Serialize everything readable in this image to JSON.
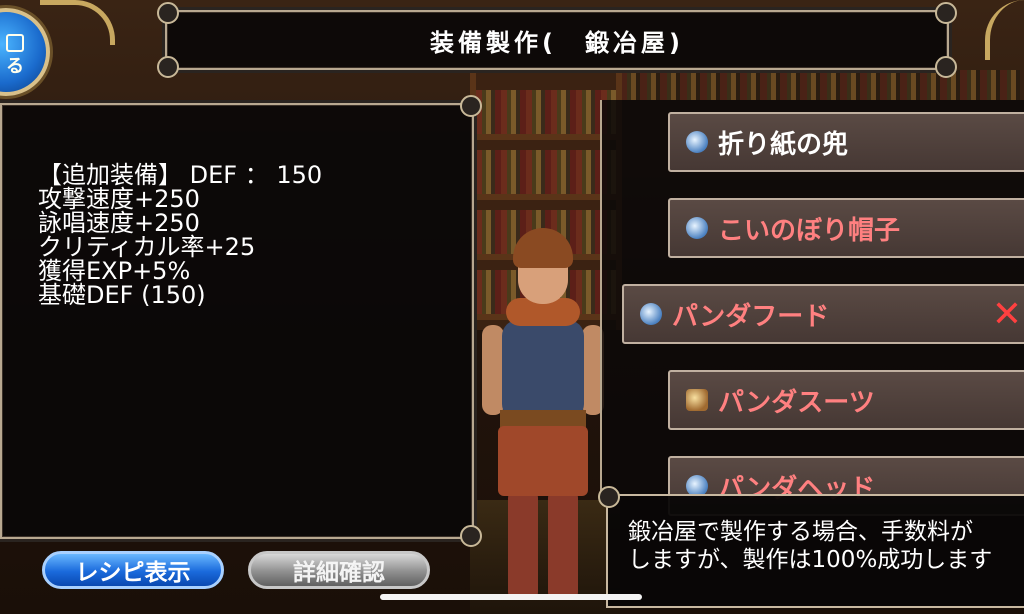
{
  "title": "装備製作(　鍛冶屋)",
  "back_button_label": "る",
  "stats": {
    "lines": [
      "【追加装備】 DEF ： 150",
      "攻撃速度+250",
      "詠唱速度+250",
      "クリティカル率+25",
      "獲得EXP+5%",
      "基礎DEF (150)"
    ]
  },
  "items": [
    {
      "label": "折り紙の兜",
      "color": "#ffffff",
      "icon": "helmet-icon"
    },
    {
      "label": "こいのぼり帽子",
      "color": "#ff8080",
      "icon": "helmet-icon"
    },
    {
      "label": "パンダフード",
      "color": "#ff8080",
      "icon": "helmet-icon",
      "mark": "✕"
    },
    {
      "label": "パンダスーツ",
      "color": "#ff8080",
      "icon": "suit-icon"
    },
    {
      "label": "パンダヘッド",
      "color": "#ff8080",
      "icon": "helmet-icon"
    }
  ],
  "tooltip": {
    "line1": "鍛冶屋で製作する場合、手数料が",
    "line2": "しますが、製作は100%成功します"
  },
  "buttons": {
    "recipe": "レシピ表示",
    "detail": "詳細確認"
  }
}
